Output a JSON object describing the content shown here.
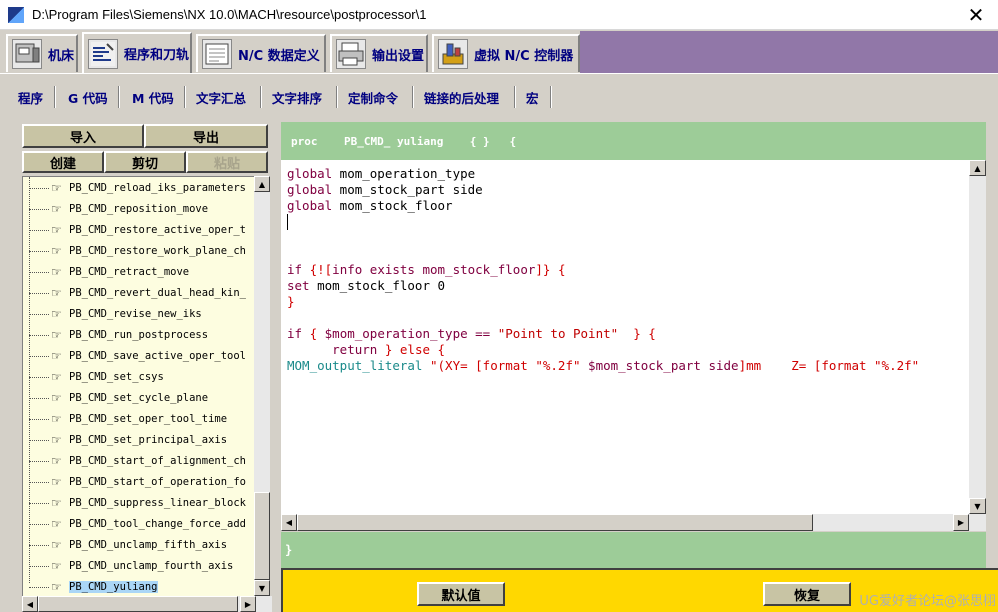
{
  "window": {
    "title": "D:\\Program Files\\Siemens\\NX 10.0\\MACH\\resource\\postprocessor\\1",
    "close_glyph": "✕"
  },
  "main_tabs": [
    {
      "label": "机床",
      "icon": "machine-tool-icon"
    },
    {
      "label": "程序和刀轨",
      "icon": "program-toolpath-icon"
    },
    {
      "label": "N/C 数据定义",
      "icon": "nc-data-definition-icon"
    },
    {
      "label": "输出设置",
      "icon": "printer-icon"
    },
    {
      "label": "虚拟 N/C 控制器",
      "icon": "virtual-controller-icon"
    }
  ],
  "sub_tabs": [
    "程序",
    "G 代码",
    "M 代码",
    "文字汇总",
    "文字排序",
    "定制命令",
    "链接的后处理",
    "宏"
  ],
  "left_panel": {
    "import_label": "导入",
    "export_label": "导出",
    "create_label": "创建",
    "cut_label": "剪切",
    "paste_label": "粘贴",
    "tree_items": [
      "PB_CMD_reload_iks_parameters",
      "PB_CMD_reposition_move",
      "PB_CMD_restore_active_oper_t",
      "PB_CMD_restore_work_plane_ch",
      "PB_CMD_retract_move",
      "PB_CMD_revert_dual_head_kin_",
      "PB_CMD_revise_new_iks",
      "PB_CMD_run_postprocess",
      "PB_CMD_save_active_oper_tool",
      "PB_CMD_set_csys",
      "PB_CMD_set_cycle_plane",
      "PB_CMD_set_oper_tool_time",
      "PB_CMD_set_principal_axis",
      "PB_CMD_start_of_alignment_ch",
      "PB_CMD_start_of_operation_fo",
      "PB_CMD_suppress_linear_block",
      "PB_CMD_tool_change_force_add",
      "PB_CMD_unclamp_fifth_axis",
      "PB_CMD_unclamp_fourth_axis",
      "PB_CMD_yuliang"
    ],
    "selected_item": "PB_CMD_yuliang"
  },
  "editor": {
    "header": "proc    PB_CMD_ yuliang    { }   {",
    "footer": "}",
    "lines": {
      "l1_kw": "global",
      "l1_var": " mom_operation_type",
      "l2_kw": "global",
      "l2_var": " mom_stock_part side",
      "l3_kw": "global",
      "l3_var": " mom_stock_floor",
      "l5_kw": "if",
      "l5_a": " {![",
      "l5_b": "info exists mom_stock_floor",
      "l5_c": "]} {",
      "l6_kw": "set",
      "l6_var": " mom_stock_floor 0",
      "l7": "}",
      "l9_kw": "if",
      "l9_a": " { ",
      "l9_b": "$mom_operation_type == ",
      "l9_str": "\"Point to Point\"",
      "l9_c": "  } {",
      "l10_indent": "      ",
      "l10_kw": "return",
      "l10_a": " } else {",
      "l11_cmd": "MOM_output_literal",
      "l11_a": " \"(XY= [format \"%.2f\" ",
      "l11_b": "$mom_stock_part side",
      "l11_c": "]mm    Z= [format \"%.2f\""
    }
  },
  "bottom": {
    "default_label": "默认值",
    "restore_label": "恢复"
  },
  "watermark": "UG爱好者论坛@张思栩",
  "colors": {
    "header_green": "#9dcc98",
    "bottom_yellow": "#ffd800",
    "tab_purple": "#9177a8",
    "tree_bg": "#fdfde0",
    "selected": "#aad6f6"
  }
}
